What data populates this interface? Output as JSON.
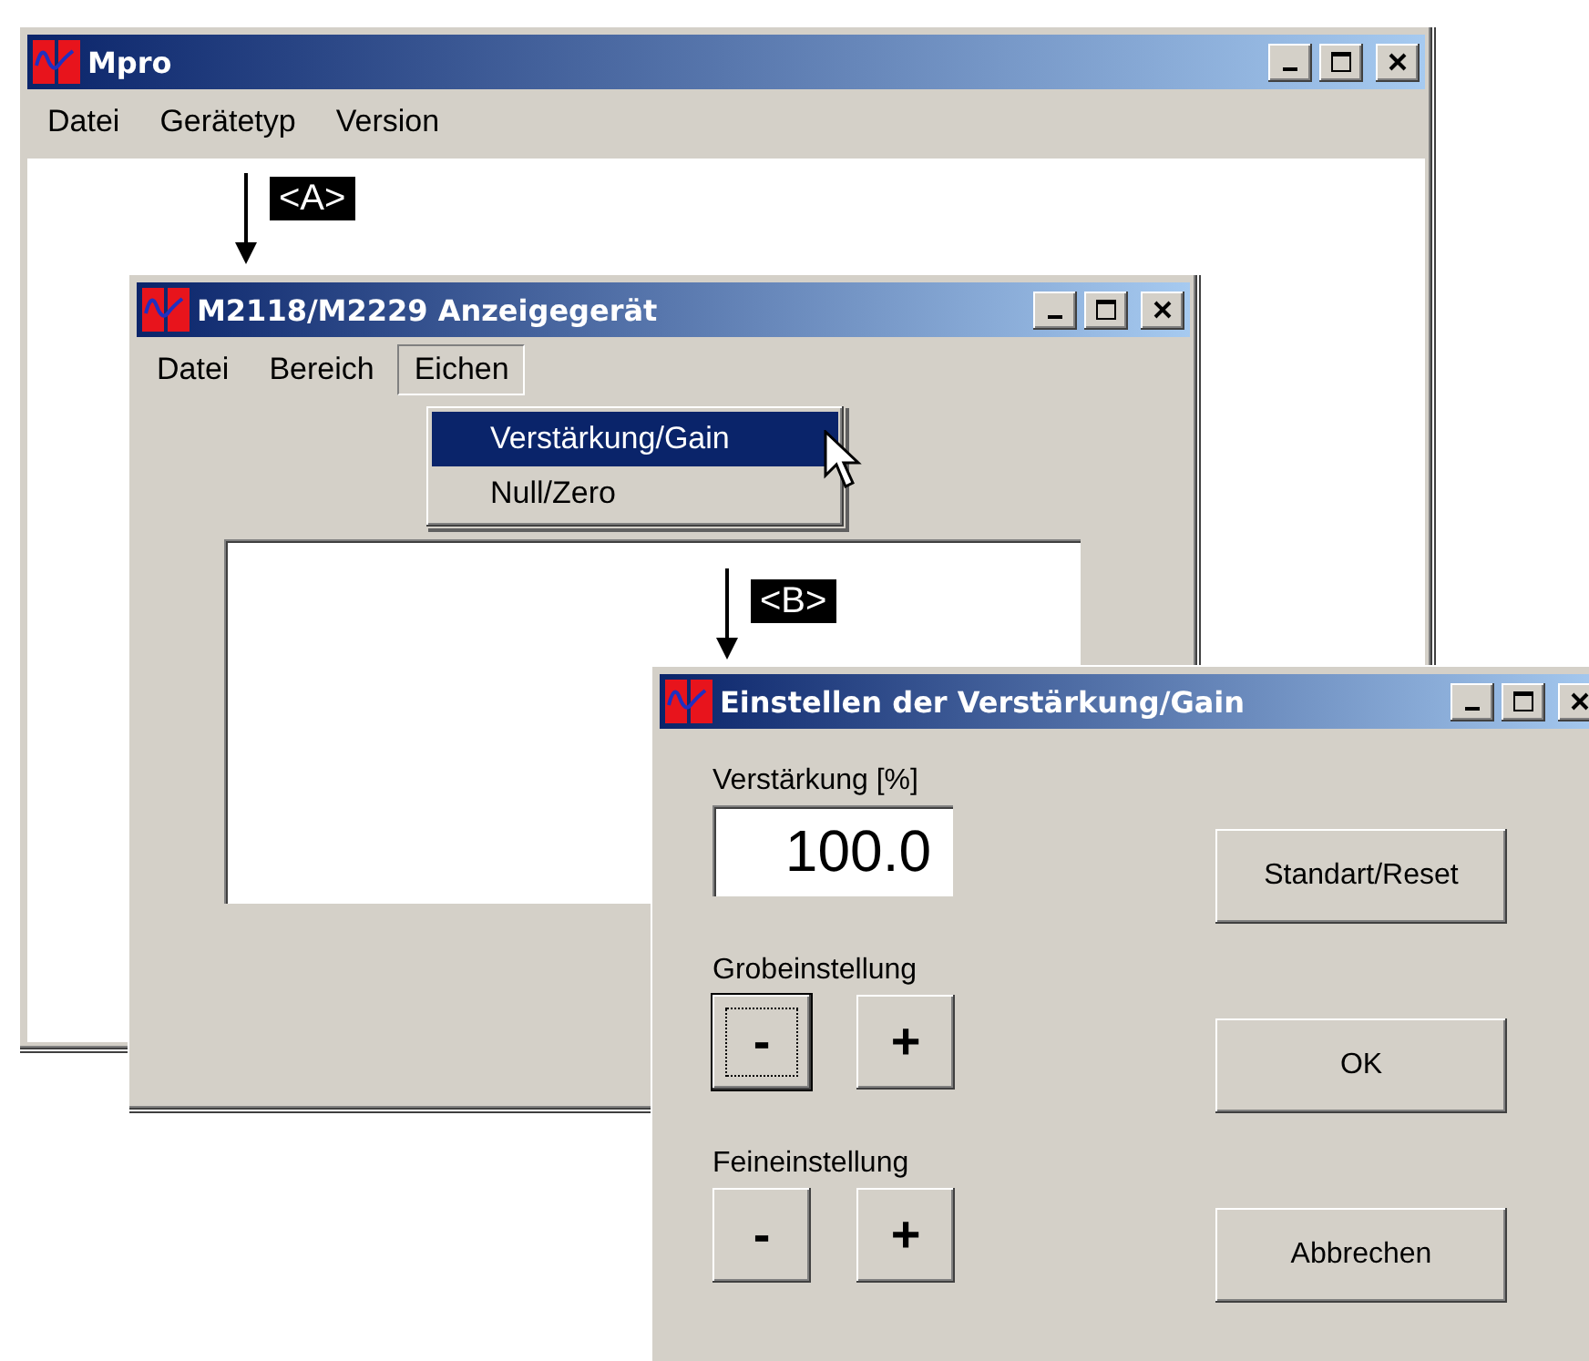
{
  "windows": [
    {
      "kind": "main",
      "title": "Mpro",
      "menu": [
        {
          "label": "Datei",
          "open": false
        },
        {
          "label": "Gerätetyp",
          "open": false
        },
        {
          "label": "Version",
          "open": false
        }
      ]
    },
    {
      "kind": "child",
      "title": "M2118/M2229 Anzeigegerät",
      "menu": [
        {
          "label": "Datei",
          "open": false
        },
        {
          "label": "Bereich",
          "open": false
        },
        {
          "label": "Eichen",
          "open": true
        }
      ],
      "dropdown": [
        {
          "label": "Verstärkung/Gain",
          "selected": true
        },
        {
          "label": "Null/Zero",
          "selected": false
        }
      ]
    },
    {
      "kind": "dialog",
      "title": "Einstellen der Verstärkung/Gain",
      "gain": {
        "label": "Verstärkung [%]",
        "value": "100.0"
      },
      "coarse": {
        "label": "Grobeinstellung",
        "buttons": [
          {
            "label": "-",
            "focused": true
          },
          {
            "label": "+",
            "focused": false
          }
        ]
      },
      "fine": {
        "label": "Feineinstellung",
        "buttons": [
          {
            "label": "-",
            "focused": false
          },
          {
            "label": "+",
            "focused": false
          }
        ]
      },
      "actions": [
        {
          "label": "Standart/Reset"
        },
        {
          "label": "OK"
        },
        {
          "label": "Abbrechen"
        }
      ]
    }
  ],
  "annotations": [
    {
      "label": "<A>"
    },
    {
      "label": "<B>"
    }
  ]
}
